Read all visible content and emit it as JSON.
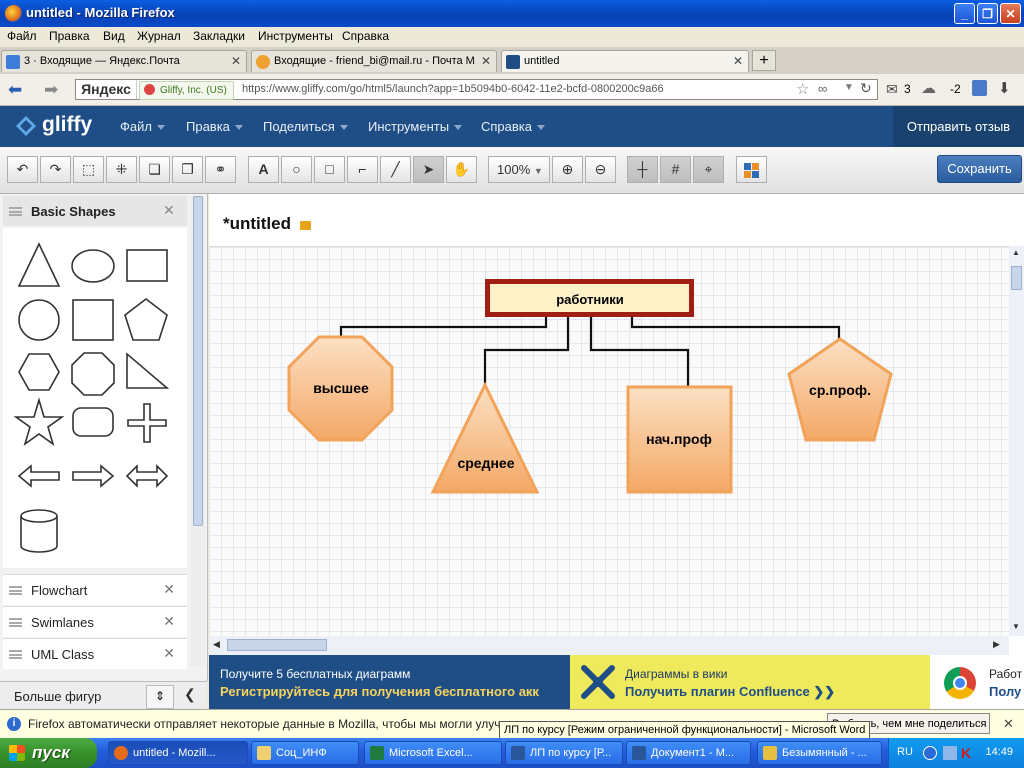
{
  "window": {
    "title": "untitled - Mozilla Firefox"
  },
  "menu": [
    "Файл",
    "Правка",
    "Вид",
    "Журнал",
    "Закладки",
    "Инструменты",
    "Справка"
  ],
  "tabs": [
    {
      "label": "3 · Входящие — Яндекс.Почта",
      "active": false
    },
    {
      "label": "Входящие - friend_bi@mail.ru - Почта M...",
      "active": false
    },
    {
      "label": "untitled",
      "active": true
    }
  ],
  "nav": {
    "yandex": "Яндекс",
    "identity": "Gliffy, Inc. (US)",
    "url": "https://www.gliffy.com/go/html5/launch?app=1b5094b0-6042-11e2-bcfd-0800200c9a66",
    "mail_count": "3",
    "weather": "-2"
  },
  "gliffy": {
    "logo": "gliffy",
    "menu": [
      "Файл",
      "Правка",
      "Поделиться",
      "Инструменты",
      "Справка"
    ],
    "feedback": "Отправить отзыв",
    "zoom": "100%",
    "save": "Сохранить",
    "doc_title": "*untitled"
  },
  "sidebar": {
    "title": "Basic Shapes",
    "libraries": [
      "Flowchart",
      "Swimlanes",
      "UML Class"
    ],
    "more": "Больше фигур"
  },
  "diagram": {
    "root": "работники",
    "children": [
      "высшее",
      "среднее",
      "нач.проф",
      "ср.проф."
    ]
  },
  "ads": [
    {
      "line1": "Получите 5 бесплатных диаграмм",
      "line2": "Регистрируйтесь для получения бесплатного акк"
    },
    {
      "line1": "Диаграммы в вики",
      "line2": "Получить плагин Confluence  ❯❯"
    },
    {
      "line1": "Работ",
      "line2": "Полу"
    }
  ],
  "notification": {
    "text": "Firefox автоматически отправляет некоторые данные в Mozilla, чтобы мы могли улучшить в",
    "button": "Выбрать, чем мне поделиться",
    "tooltip": "ЛП по курсу [Режим ограниченной функциональности] - Microsoft Word"
  },
  "taskbar": {
    "start": "пуск",
    "tasks": [
      "untitled - Mozill...",
      "Соц_ИНФ",
      "Microsoft Excel...",
      "ЛП по курсу [Р...",
      "Документ1 - М...",
      "Безымянный - ..."
    ],
    "lang": "RU",
    "clock": "14:49"
  },
  "colors": {
    "gliffy_header": "#1F4E87",
    "shape_fill": "#F6B57A",
    "root_border": "#A01E14",
    "root_fill": "#FDF1C8"
  }
}
